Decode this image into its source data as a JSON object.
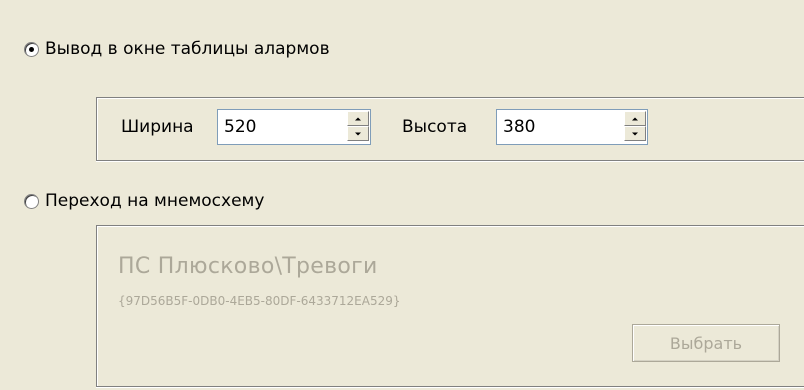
{
  "option_table": {
    "label": "Вывод в окне таблицы алармов",
    "selected": true,
    "width_label": "Ширина",
    "width_value": "520",
    "height_label": "Высота",
    "height_value": "380"
  },
  "option_mnemo": {
    "label": "Переход на мнемосхему",
    "selected": false,
    "screen_name": "ПС Плюсково\\Тревоги",
    "screen_guid": "{97D56B5F-0DB0-4EB5-80DF-6433712EA529}",
    "pick_button": "Выбрать"
  },
  "colors": {
    "background": "#ece9d8",
    "disabled_text": "#aca899",
    "field_border": "#7f9db9"
  }
}
